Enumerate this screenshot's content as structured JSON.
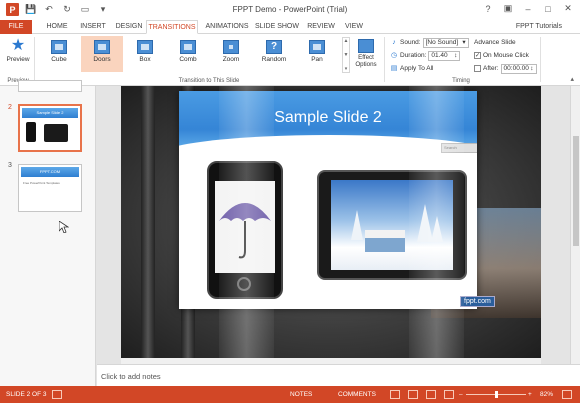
{
  "window": {
    "title": "FPPT Demo - PowerPoint (Trial)",
    "account": "FPPT Tutorials"
  },
  "qat": {
    "logo": "P"
  },
  "tabs": [
    {
      "label": "FILE"
    },
    {
      "label": "HOME"
    },
    {
      "label": "INSERT"
    },
    {
      "label": "DESIGN"
    },
    {
      "label": "TRANSITIONS"
    },
    {
      "label": "ANIMATIONS"
    },
    {
      "label": "SLIDE SHOW"
    },
    {
      "label": "REVIEW"
    },
    {
      "label": "VIEW"
    }
  ],
  "ribbon": {
    "preview": {
      "label": "Preview",
      "group": "Preview"
    },
    "transitions": [
      {
        "label": "Cube",
        "icon": "cube-icon"
      },
      {
        "label": "Doors",
        "icon": "doors-icon"
      },
      {
        "label": "Box",
        "icon": "box-icon"
      },
      {
        "label": "Comb",
        "icon": "comb-icon"
      },
      {
        "label": "Zoom",
        "icon": "zoom-icon"
      },
      {
        "label": "Random",
        "icon": "random-icon"
      },
      {
        "label": "Pan",
        "icon": "pan-icon"
      }
    ],
    "random_glyph": "?",
    "gallery_group": "Transition to This Slide",
    "effect_options_line1": "Effect",
    "effect_options_line2": "Options",
    "timing": {
      "sound_label": "Sound:",
      "sound_value": "[No Sound]",
      "duration_label": "Duration:",
      "duration_value": "01.40",
      "apply_all": "Apply To All",
      "advance_slide": "Advance Slide",
      "on_mouse_click": "On Mouse Click",
      "after_label": "After:",
      "after_value": "00:00.00",
      "group": "Timing"
    }
  },
  "thumbnails": [
    {
      "number": "2"
    },
    {
      "number": "3",
      "title": "FPPT.COM",
      "text": "Free PowerPoint Templates"
    }
  ],
  "slide": {
    "title": "Sample Slide 2",
    "search_placeholder": "Search",
    "badge": "fppt.com"
  },
  "notes": {
    "placeholder": "Click to add notes"
  },
  "status": {
    "slide_info": "SLIDE 2 OF 3",
    "notes": "NOTES",
    "comments": "COMMENTS",
    "zoom": "82%",
    "zoom_level": 0.5
  }
}
